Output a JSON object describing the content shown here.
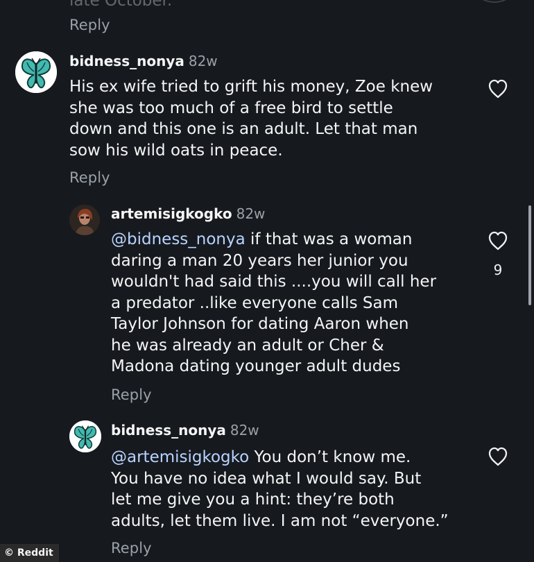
{
  "top_fragment": {
    "cut_text": "late October.",
    "reply_label": "Reply"
  },
  "comments": [
    {
      "username": "bidness_nonya",
      "time": "82w",
      "text": "His ex wife tried to grift his money, Zoe knew\nshe was too much of a free bird to settle\ndown and this one is an adult. Let that man\nsow his wild oats in peace.",
      "reply_label": "Reply",
      "avatar_icon": "butterfly-icon"
    },
    {
      "username": "artemisigkogko",
      "time": "82w",
      "mention": "@bidness_nonya",
      "text_after_mention": " if that was a woman\ndaring a man 20 years her junior you\nwouldn't had said this ....you will call her\na predator ..like everyone calls Sam\nTaylor Johnson for dating Aaron when\nhe was already an adult or Cher &\nMadona dating younger adult dudes",
      "like_count": "9",
      "reply_label": "Reply",
      "avatar_icon": "profile-photo"
    },
    {
      "username": "bidness_nonya",
      "time": "82w",
      "mention": "@artemisigkogko",
      "text_after_mention": " You don’t know me.\nYou have no idea what I would say. But\nlet me give you a hint: they’re both\nadults, let them live. I am not “everyone.”",
      "reply_label": "Reply",
      "avatar_icon": "butterfly-icon"
    }
  ],
  "watermark": {
    "text": "© Reddit"
  },
  "colors": {
    "background": "#161a1f",
    "text": "#f5f5f5",
    "muted": "#9ba1a8",
    "mention": "#b9d3ff",
    "butterfly": "#3fb6a8"
  }
}
